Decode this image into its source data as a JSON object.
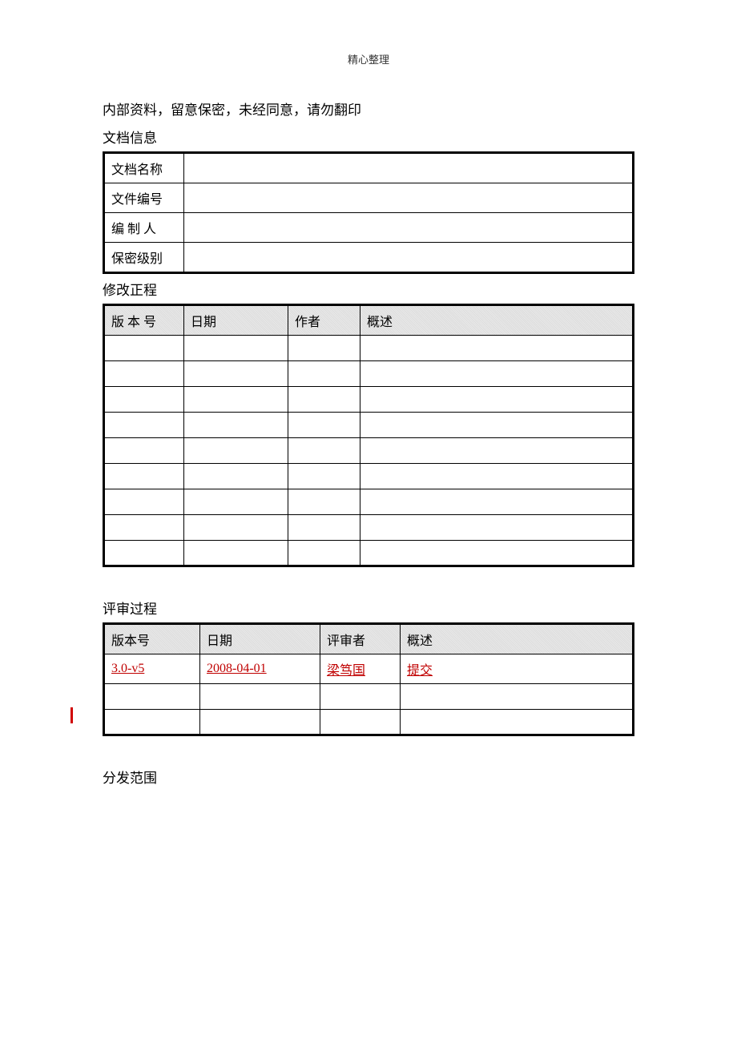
{
  "header": "精心整理",
  "notice": "内部资料，留意保密，未经同意，请勿翻印",
  "section_info_label": "文档信息",
  "info_rows": {
    "r1": "文档名称",
    "r2": "文件编号",
    "r3": "编 制 人",
    "r4": "保密级别"
  },
  "section_revision_label": "修改正程",
  "revision_headers": {
    "c1": "版 本 号",
    "c2": "日期",
    "c3": "作者",
    "c4": "概述"
  },
  "section_review_label": "评审过程",
  "review_headers": {
    "c1": "版本号",
    "c2": "日期",
    "c3": "评审者",
    "c4": "概述"
  },
  "review_row1": {
    "version": "3.0-v5",
    "date": "2008-04-01",
    "reviewer": "梁笃国",
    "summary": "提交"
  },
  "section_distribution_label": "分发范围"
}
